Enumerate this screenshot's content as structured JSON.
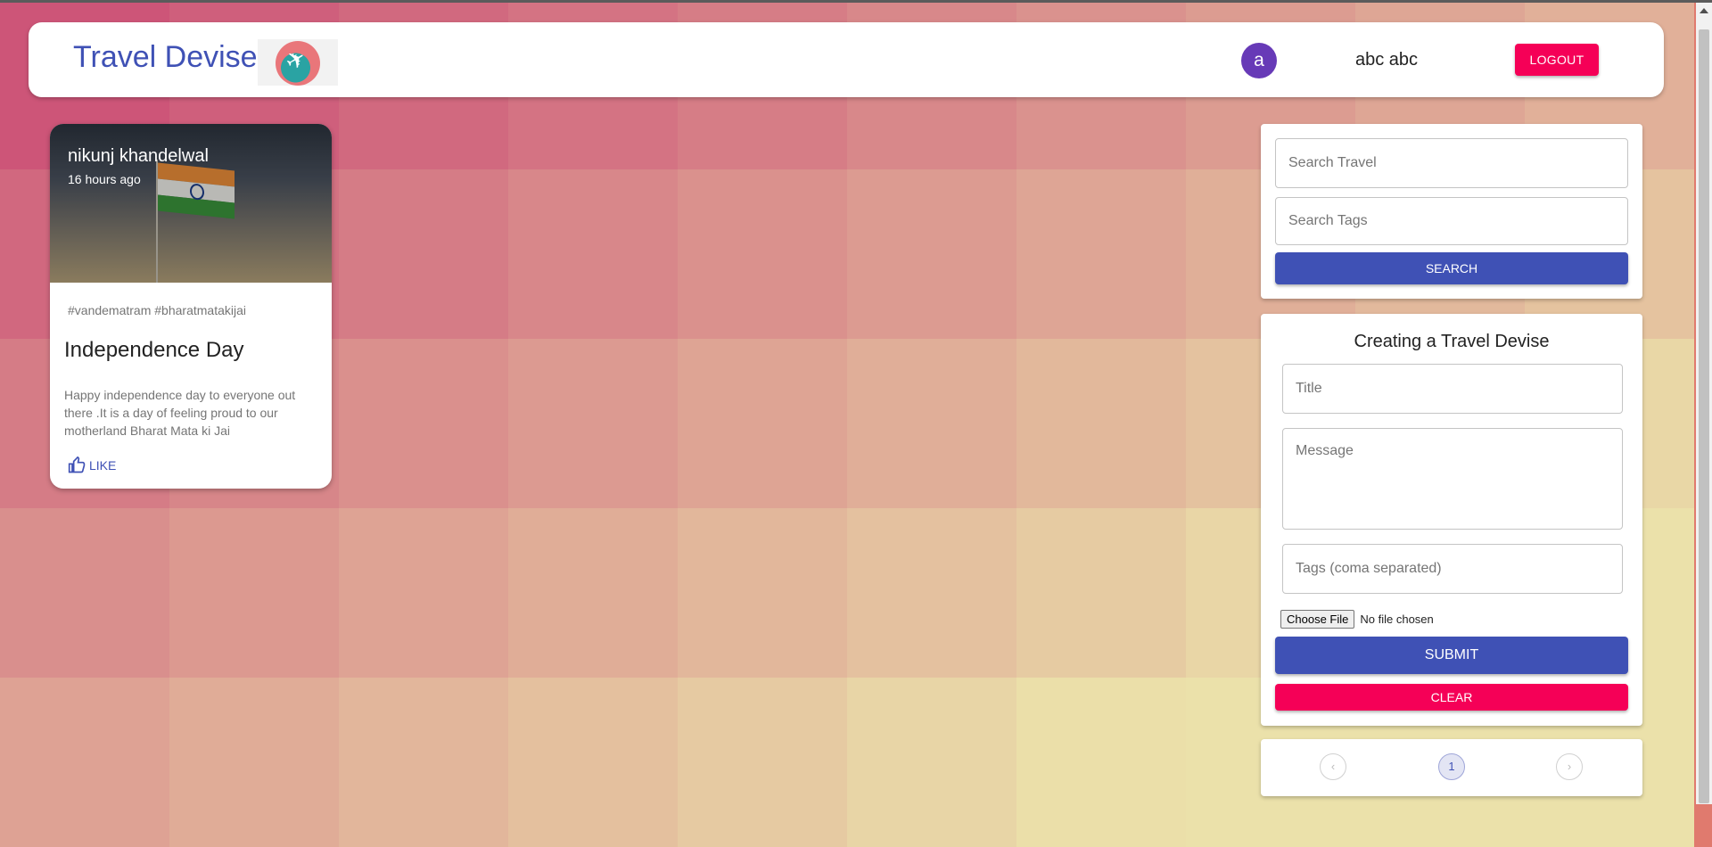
{
  "header": {
    "brand": "Travel Devise",
    "avatar_letter": "a",
    "username": "abc abc",
    "logout_label": "LOGOUT"
  },
  "post": {
    "creator": "nikunj khandelwal",
    "time": "16 hours ago",
    "tags": "#vandematram #bharatmatakijai",
    "title": "Independence Day",
    "message": "Happy independence day to everyone out there .It is a day of feeling proud to our motherland Bharat Mata ki Jai",
    "like_label": "LIKE"
  },
  "search": {
    "travel_placeholder": "Search Travel",
    "tags_placeholder": "Search Tags",
    "button": "SEARCH"
  },
  "form": {
    "heading": "Creating a Travel Devise",
    "title_placeholder": "Title",
    "message_placeholder": "Message",
    "tags_placeholder": "Tags (coma separated)",
    "choose_file": "Choose File",
    "no_file": "No file chosen",
    "submit": "SUBMIT",
    "clear": "CLEAR"
  },
  "pagination": {
    "current_page": "1",
    "prev_icon": "chevron-left-icon",
    "next_icon": "chevron-right-icon"
  },
  "colors": {
    "primary": "#3f51b5",
    "secondary": "#f50057",
    "avatar": "#673ab7"
  }
}
